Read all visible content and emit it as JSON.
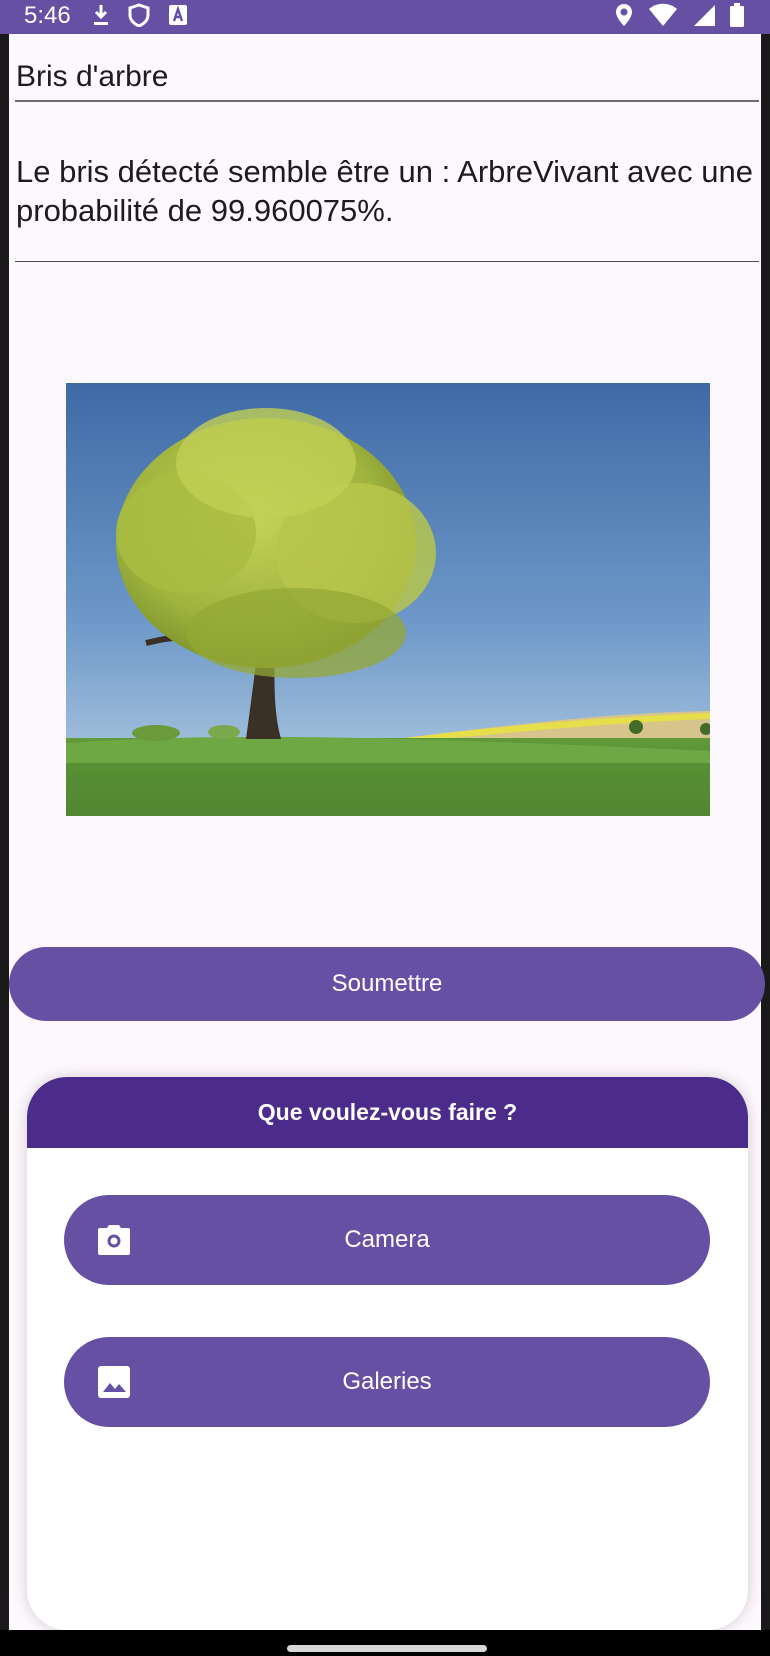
{
  "status_bar": {
    "time": "5:46",
    "left_icons": [
      "download-icon",
      "shield-icon",
      "app-a-icon"
    ],
    "right_icons": [
      "location-icon",
      "wifi-icon",
      "signal-icon",
      "battery-icon"
    ]
  },
  "form": {
    "title_value": "Bris d'arbre",
    "result_text": "Le bris détecté semble être un : ArbreVivant avec une probabilité de 99.960075%."
  },
  "image": {
    "alt": "Arbre"
  },
  "submit_label": "Soumettre",
  "sheet": {
    "title": "Que voulez-vous faire ?",
    "actions": [
      {
        "label": "Camera",
        "icon": "camera-icon"
      },
      {
        "label": "Galeries",
        "icon": "image-icon"
      }
    ]
  },
  "colors": {
    "primary": "#6650a4",
    "sheet_header": "#4b2c8a",
    "background": "#fdf8fd"
  }
}
